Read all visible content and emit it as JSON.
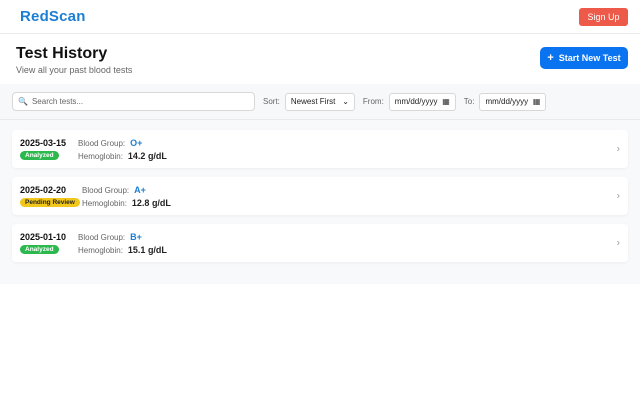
{
  "nav": {
    "brand": "RedScan",
    "signup_label": "Sign Up"
  },
  "header": {
    "title": "Test History",
    "subtitle": "View all your past blood tests",
    "start_label": "Start New Test",
    "start_icon": "plus-icon"
  },
  "filters": {
    "search_placeholder": "Search tests...",
    "sort_label": "Sort:",
    "sort_value": "Newest First",
    "from_label": "From:",
    "from_value": "mm/dd/yyyy",
    "to_label": "To:",
    "to_value": "mm/dd/yyyy"
  },
  "tests": [
    {
      "date": "2025-03-15",
      "status": "Analyzed",
      "blood_group_label": "Blood Group:",
      "blood_group": "O+",
      "hemoglobin_label": "Hemoglobin:",
      "hemoglobin": "14.2 g/dL"
    },
    {
      "date": "2025-02-20",
      "status": "Pending Review",
      "blood_group_label": "Blood Group:",
      "blood_group": "A+",
      "hemoglobin_label": "Hemoglobin:",
      "hemoglobin": "12.8 g/dL"
    },
    {
      "date": "2025-01-10",
      "status": "Analyzed",
      "blood_group_label": "Blood Group:",
      "blood_group": "B+",
      "hemoglobin_label": "Hemoglobin:",
      "hemoglobin": "15.1 g/dL"
    }
  ],
  "colors": {
    "brand": "#1a7fd4",
    "signup": "#ee5a4a",
    "primary": "#0a73f0",
    "analyzed": "#2db84d",
    "pending": "#f2c71b"
  }
}
